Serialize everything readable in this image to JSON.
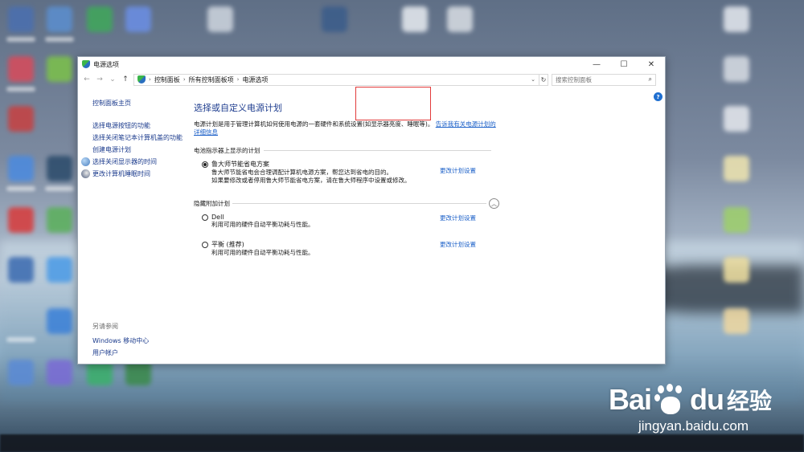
{
  "window": {
    "title": "电源选项",
    "minimize": "—",
    "maximize": "☐",
    "close": "✕"
  },
  "address": {
    "crumbs": [
      "控制面板",
      "所有控制面板项",
      "电源选项"
    ],
    "search_placeholder": "搜索控制面板"
  },
  "sidebar": {
    "home": "控制面板主页",
    "links": [
      "选择电源按钮的功能",
      "选择关闭笔记本计算机盖的功能",
      "创建电源计划",
      "选择关闭显示器的时间",
      "更改计算机睡眠时间"
    ],
    "see_also_title": "另请参阅",
    "see_also": [
      "Windows 移动中心",
      "用户帐户"
    ]
  },
  "main": {
    "title": "选择或自定义电源计划",
    "description": "电源计划是用于管理计算机如何使用电源的一套硬件和系统设置(如显示器亮度、睡眠等)。",
    "description_link": "告诉我有关电源计划的详细信息",
    "battery_section": "电池指示器上显示的计划",
    "hidden_section": "隐藏附加计划",
    "plans": [
      {
        "name": "鲁大师节能省电方案",
        "selected": true,
        "desc": [
          "鲁大师节能省电会合理调配计算机电源方案，帮您达到省电的目的。",
          "如果要修改或者停用鲁大师节能省电方案，请在鲁大师程序中设置或修改。"
        ],
        "change": "更改计划设置"
      },
      {
        "name": "Dell",
        "selected": false,
        "desc": [
          "利用可用的硬件自动平衡功耗与性能。"
        ],
        "change": "更改计划设置"
      },
      {
        "name": "平衡 (推荐)",
        "selected": false,
        "desc": [
          "利用可用的硬件自动平衡功耗与性能。"
        ],
        "change": "更改计划设置"
      }
    ]
  },
  "watermark": {
    "brand": "Bai",
    "brand2": "du",
    "cn": "经验",
    "url": "jingyan.baidu.com"
  },
  "colors": {
    "link": "#1a5fc8",
    "title": "#1e3d8f",
    "highlight": "#e23b3b"
  }
}
